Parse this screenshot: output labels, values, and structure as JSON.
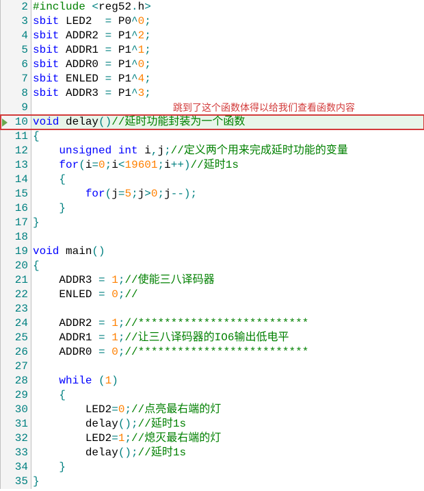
{
  "annotation_text": "跳到了这个函数体得以给我们查看函数内容",
  "lines": [
    {
      "num": "2",
      "marker": false,
      "tokens": [
        [
          "preproc",
          "#include"
        ],
        [
          "ident",
          " "
        ],
        [
          "op",
          "<"
        ],
        [
          "ident",
          "reg52"
        ],
        [
          "op",
          "."
        ],
        [
          "ident",
          "h"
        ],
        [
          "op",
          ">"
        ]
      ]
    },
    {
      "num": "3",
      "marker": false,
      "tokens": [
        [
          "kw",
          "sbit"
        ],
        [
          "ident",
          " LED2  "
        ],
        [
          "op",
          "="
        ],
        [
          "ident",
          " P0"
        ],
        [
          "op",
          "^"
        ],
        [
          "num",
          "0"
        ],
        [
          "op",
          ";"
        ]
      ]
    },
    {
      "num": "4",
      "marker": false,
      "tokens": [
        [
          "kw",
          "sbit"
        ],
        [
          "ident",
          " ADDR2 "
        ],
        [
          "op",
          "="
        ],
        [
          "ident",
          " P1"
        ],
        [
          "op",
          "^"
        ],
        [
          "num",
          "2"
        ],
        [
          "op",
          ";"
        ]
      ]
    },
    {
      "num": "5",
      "marker": false,
      "tokens": [
        [
          "kw",
          "sbit"
        ],
        [
          "ident",
          " ADDR1 "
        ],
        [
          "op",
          "="
        ],
        [
          "ident",
          " P1"
        ],
        [
          "op",
          "^"
        ],
        [
          "num",
          "1"
        ],
        [
          "op",
          ";"
        ]
      ]
    },
    {
      "num": "6",
      "marker": false,
      "tokens": [
        [
          "kw",
          "sbit"
        ],
        [
          "ident",
          " ADDR0 "
        ],
        [
          "op",
          "="
        ],
        [
          "ident",
          " P1"
        ],
        [
          "op",
          "^"
        ],
        [
          "num",
          "0"
        ],
        [
          "op",
          ";"
        ]
      ]
    },
    {
      "num": "7",
      "marker": false,
      "tokens": [
        [
          "kw",
          "sbit"
        ],
        [
          "ident",
          " ENLED "
        ],
        [
          "op",
          "="
        ],
        [
          "ident",
          " P1"
        ],
        [
          "op",
          "^"
        ],
        [
          "num",
          "4"
        ],
        [
          "op",
          ";"
        ]
      ]
    },
    {
      "num": "8",
      "marker": false,
      "tokens": [
        [
          "kw",
          "sbit"
        ],
        [
          "ident",
          " ADDR3 "
        ],
        [
          "op",
          "="
        ],
        [
          "ident",
          " P1"
        ],
        [
          "op",
          "^"
        ],
        [
          "num",
          "3"
        ],
        [
          "op",
          ";"
        ]
      ]
    },
    {
      "num": "9",
      "marker": false,
      "tokens": []
    },
    {
      "num": "10",
      "marker": true,
      "hl": true,
      "tokens": [
        [
          "kw",
          "void"
        ],
        [
          "ident",
          " delay"
        ],
        [
          "op",
          "()"
        ],
        [
          "cmt",
          "//延时功能封装为一个函数"
        ]
      ]
    },
    {
      "num": "11",
      "marker": false,
      "tokens": [
        [
          "op",
          "{"
        ]
      ]
    },
    {
      "num": "12",
      "marker": false,
      "tokens": [
        [
          "ident",
          "    "
        ],
        [
          "kw",
          "unsigned"
        ],
        [
          "ident",
          " "
        ],
        [
          "kw",
          "int"
        ],
        [
          "ident",
          " i"
        ],
        [
          "op",
          ","
        ],
        [
          "ident",
          "j"
        ],
        [
          "op",
          ";"
        ],
        [
          "cmt",
          "//定义两个用来完成延时功能的变量"
        ]
      ]
    },
    {
      "num": "13",
      "marker": false,
      "tokens": [
        [
          "ident",
          "    "
        ],
        [
          "kw",
          "for"
        ],
        [
          "op",
          "("
        ],
        [
          "ident",
          "i"
        ],
        [
          "op",
          "="
        ],
        [
          "num",
          "0"
        ],
        [
          "op",
          ";"
        ],
        [
          "ident",
          "i"
        ],
        [
          "op",
          "<"
        ],
        [
          "num",
          "19601"
        ],
        [
          "op",
          ";"
        ],
        [
          "ident",
          "i"
        ],
        [
          "op",
          "++)"
        ],
        [
          "cmt",
          "//延时1s"
        ]
      ]
    },
    {
      "num": "14",
      "marker": false,
      "tokens": [
        [
          "ident",
          "    "
        ],
        [
          "op",
          "{"
        ]
      ]
    },
    {
      "num": "15",
      "marker": false,
      "tokens": [
        [
          "ident",
          "        "
        ],
        [
          "kw",
          "for"
        ],
        [
          "op",
          "("
        ],
        [
          "ident",
          "j"
        ],
        [
          "op",
          "="
        ],
        [
          "num",
          "5"
        ],
        [
          "op",
          ";"
        ],
        [
          "ident",
          "j"
        ],
        [
          "op",
          ">"
        ],
        [
          "num",
          "0"
        ],
        [
          "op",
          ";"
        ],
        [
          "ident",
          "j"
        ],
        [
          "op",
          "--);"
        ]
      ]
    },
    {
      "num": "16",
      "marker": false,
      "tokens": [
        [
          "ident",
          "    "
        ],
        [
          "op",
          "}"
        ]
      ]
    },
    {
      "num": "17",
      "marker": false,
      "tokens": [
        [
          "op",
          "}"
        ]
      ]
    },
    {
      "num": "18",
      "marker": false,
      "tokens": []
    },
    {
      "num": "19",
      "marker": false,
      "tokens": [
        [
          "kw",
          "void"
        ],
        [
          "ident",
          " main"
        ],
        [
          "op",
          "()"
        ]
      ]
    },
    {
      "num": "20",
      "marker": false,
      "tokens": [
        [
          "op",
          "{"
        ]
      ]
    },
    {
      "num": "21",
      "marker": false,
      "tokens": [
        [
          "ident",
          "    ADDR3 "
        ],
        [
          "op",
          "="
        ],
        [
          "ident",
          " "
        ],
        [
          "num",
          "1"
        ],
        [
          "op",
          ";"
        ],
        [
          "cmt",
          "//使能三八译码器"
        ]
      ]
    },
    {
      "num": "22",
      "marker": false,
      "tokens": [
        [
          "ident",
          "    ENLED "
        ],
        [
          "op",
          "="
        ],
        [
          "ident",
          " "
        ],
        [
          "num",
          "0"
        ],
        [
          "op",
          ";"
        ],
        [
          "cmt",
          "//"
        ]
      ]
    },
    {
      "num": "23",
      "marker": false,
      "tokens": []
    },
    {
      "num": "24",
      "marker": false,
      "tokens": [
        [
          "ident",
          "    ADDR2 "
        ],
        [
          "op",
          "="
        ],
        [
          "ident",
          " "
        ],
        [
          "num",
          "1"
        ],
        [
          "op",
          ";"
        ],
        [
          "cmt",
          "//**************************"
        ]
      ]
    },
    {
      "num": "25",
      "marker": false,
      "tokens": [
        [
          "ident",
          "    ADDR1 "
        ],
        [
          "op",
          "="
        ],
        [
          "ident",
          " "
        ],
        [
          "num",
          "1"
        ],
        [
          "op",
          ";"
        ],
        [
          "cmt",
          "//让三八译码器的IO6输出低电平"
        ]
      ]
    },
    {
      "num": "26",
      "marker": false,
      "tokens": [
        [
          "ident",
          "    ADDR0 "
        ],
        [
          "op",
          "="
        ],
        [
          "ident",
          " "
        ],
        [
          "num",
          "0"
        ],
        [
          "op",
          ";"
        ],
        [
          "cmt",
          "//**************************"
        ]
      ]
    },
    {
      "num": "27",
      "marker": false,
      "tokens": []
    },
    {
      "num": "28",
      "marker": false,
      "tokens": [
        [
          "ident",
          "    "
        ],
        [
          "kw",
          "while"
        ],
        [
          "ident",
          " "
        ],
        [
          "op",
          "("
        ],
        [
          "num",
          "1"
        ],
        [
          "op",
          ")"
        ]
      ]
    },
    {
      "num": "29",
      "marker": false,
      "tokens": [
        [
          "ident",
          "    "
        ],
        [
          "op",
          "{"
        ]
      ]
    },
    {
      "num": "30",
      "marker": false,
      "tokens": [
        [
          "ident",
          "        LED2"
        ],
        [
          "op",
          "="
        ],
        [
          "num",
          "0"
        ],
        [
          "op",
          ";"
        ],
        [
          "cmt",
          "//点亮最右端的灯"
        ]
      ]
    },
    {
      "num": "31",
      "marker": false,
      "tokens": [
        [
          "ident",
          "        delay"
        ],
        [
          "op",
          "();"
        ],
        [
          "cmt",
          "//延时1s"
        ]
      ]
    },
    {
      "num": "32",
      "marker": false,
      "tokens": [
        [
          "ident",
          "        LED2"
        ],
        [
          "op",
          "="
        ],
        [
          "num",
          "1"
        ],
        [
          "op",
          ";"
        ],
        [
          "cmt",
          "//熄灭最右端的灯"
        ]
      ]
    },
    {
      "num": "33",
      "marker": false,
      "tokens": [
        [
          "ident",
          "        delay"
        ],
        [
          "op",
          "();"
        ],
        [
          "cmt",
          "//延时1s"
        ]
      ]
    },
    {
      "num": "34",
      "marker": false,
      "tokens": [
        [
          "ident",
          "    "
        ],
        [
          "op",
          "}"
        ]
      ]
    },
    {
      "num": "35",
      "marker": false,
      "tokens": [
        [
          "op",
          "}"
        ]
      ]
    }
  ]
}
